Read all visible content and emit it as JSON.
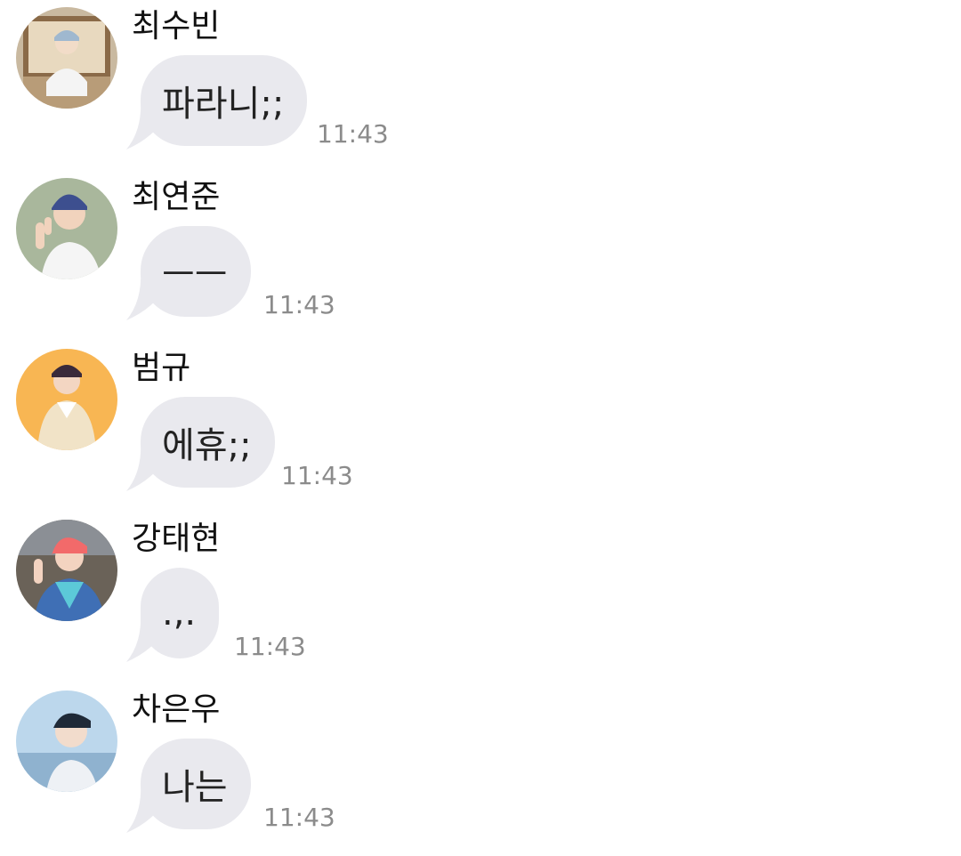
{
  "colors": {
    "background": "#ffffff",
    "bubble": "#e9e9ee",
    "sender_text": "#111111",
    "message_text": "#222222",
    "timestamp_text": "#8b8b8b"
  },
  "messages": [
    {
      "sender": "최수빈",
      "text": "파라니;;",
      "time": "11:43",
      "avatar": "profile-photo"
    },
    {
      "sender": "최연준",
      "text": "ㅡㅡ",
      "time": "11:43",
      "avatar": "profile-photo"
    },
    {
      "sender": "범규",
      "text": "에휴;;",
      "time": "11:43",
      "avatar": "profile-photo"
    },
    {
      "sender": "강태현",
      "text": ".,.",
      "time": "11:43",
      "avatar": "profile-photo"
    },
    {
      "sender": "차은우",
      "text": "나는",
      "time": "11:43",
      "avatar": "profile-photo"
    }
  ]
}
